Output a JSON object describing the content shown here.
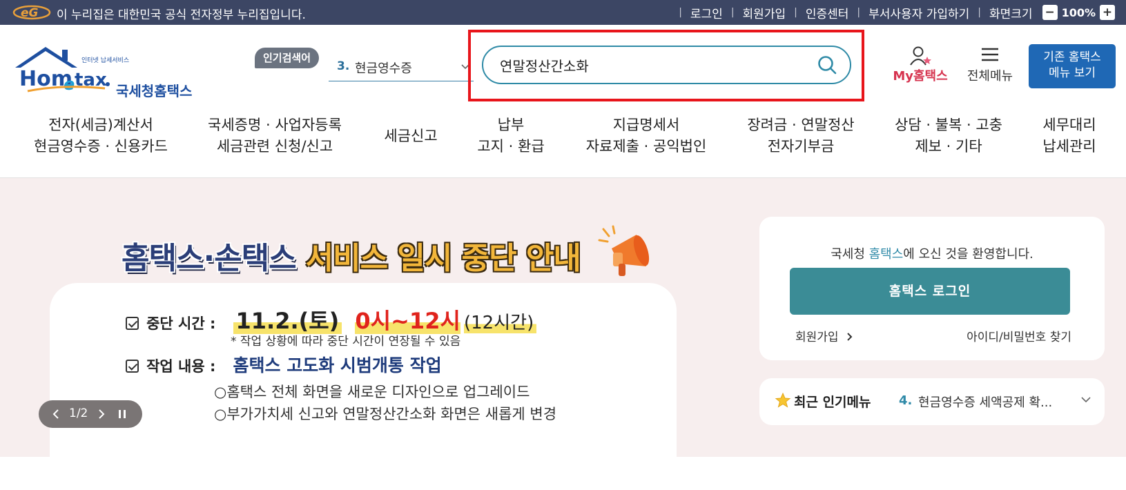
{
  "gov_bar": {
    "notice": "이 누리집은 대한민국 공식 전자정부 누리집입니다.",
    "links": [
      "로그인",
      "회원가입",
      "인증센터",
      "부서사용자 가입하기",
      "화면크기"
    ],
    "zoom_minus": "−",
    "zoom_value": "100%",
    "zoom_plus": "+"
  },
  "logo": {
    "subtitle": "인터넷 납세서비스",
    "brand": "Hometax.",
    "name_kr": "국세청홈택스"
  },
  "popular_search": {
    "badge": "인기검색어",
    "rank": "3.",
    "term": "현금영수증"
  },
  "search": {
    "value": "연말정산간소화"
  },
  "header_actions": {
    "my_hometax": "My홈택스",
    "all_menu": "전체메뉴",
    "legacy_line1": "기존 홈택스",
    "legacy_line2": "메뉴 보기"
  },
  "nav": [
    {
      "line1": "전자(세금)계산서",
      "line2": "현금영수증 · 신용카드"
    },
    {
      "line1": "국세증명 · 사업자등록",
      "line2": "세금관련 신청/신고"
    },
    {
      "line1": "세금신고",
      "line2": ""
    },
    {
      "line1": "납부",
      "line2": "고지 · 환급"
    },
    {
      "line1": "지급명세서",
      "line2": "자료제출 · 공익법인"
    },
    {
      "line1": "장려금 · 연말정산",
      "line2": "전자기부금"
    },
    {
      "line1": "상담 · 불복 · 고충",
      "line2": "제보 · 기타"
    },
    {
      "line1": "세무대리",
      "line2": "납세관리"
    }
  ],
  "banner": {
    "title_a": "홈택스·손택스",
    "title_b": "서비스 일시 중단 안내",
    "stop_time_label": "중단 시간 :",
    "stop_date": "11.2.(토)",
    "stop_hours": "0시~12시",
    "stop_duration": "(12시간)",
    "note": "* 작업 상황에 따라 중단 시간이 연장될 수 있음",
    "work_label": "작업 내용 :",
    "work_title": "홈택스 고도화 시범개통 작업",
    "bullets": [
      "○홈택스 전체 화면을 새로운 디자인으로 업그레이드",
      "○부가가치세 신고와 연말정산간소화 화면은 새롭게 변경"
    ],
    "pager": "1/2"
  },
  "login": {
    "welcome_pre": "국세청 ",
    "welcome_accent": "홈택스",
    "welcome_post": "에 오신 것을 환영합니다.",
    "button": "홈택스 로그인",
    "join": "회원가입",
    "find": "아이디/비밀번호 찾기"
  },
  "recent_popular": {
    "title": "최근 인기메뉴",
    "rank": "4.",
    "item": "현금영수증 세액공제 확..."
  },
  "colors": {
    "gov_bar": "#3c4664",
    "accent_teal": "#2e8aa6",
    "highlight": "#e8151b",
    "legacy_button": "#1f68b5",
    "login_button": "#3b8c96",
    "content_bg": "#f7eeee"
  }
}
